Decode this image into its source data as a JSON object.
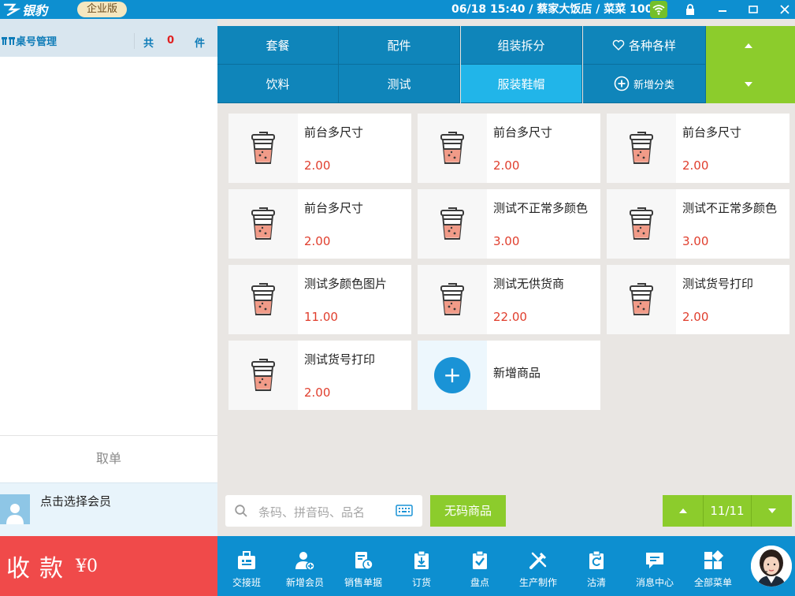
{
  "app": {
    "logo_text": "银豹",
    "edition": "企业版",
    "datetime": "06/18 15:40",
    "store": "蔡家大饭店",
    "user": "菜菜 1001"
  },
  "left_panel": {
    "title": "桌号管理",
    "total_prefix": "共",
    "total_count": "0",
    "total_suffix": "件",
    "cancel_label": "取单",
    "member_label": "点击选择会员",
    "pay_label": "收款",
    "pay_amount": "¥0"
  },
  "categories": {
    "row1": [
      "套餐",
      "配件",
      "组装拆分",
      "各种各样"
    ],
    "row2": [
      "饮料",
      "测试",
      "服装鞋帽"
    ],
    "add_label": "新增分类",
    "active": "服装鞋帽"
  },
  "products": [
    {
      "name": "前台多尺寸",
      "price": "2.00"
    },
    {
      "name": "前台多尺寸",
      "price": "2.00"
    },
    {
      "name": "前台多尺寸",
      "price": "2.00"
    },
    {
      "name": "前台多尺寸",
      "price": "2.00"
    },
    {
      "name": "测试不正常多颜色",
      "price": "3.00"
    },
    {
      "name": "测试不正常多颜色",
      "price": "3.00"
    },
    {
      "name": "测试多颜色图片",
      "price": "11.00"
    },
    {
      "name": "测试无供货商",
      "price": "22.00"
    },
    {
      "name": "测试货号打印",
      "price": "2.00"
    },
    {
      "name": "测试货号打印",
      "price": "2.00"
    }
  ],
  "add_product_label": "新增商品",
  "search": {
    "placeholder": "条码、拼音码、品名"
  },
  "no_code_label": "无码商品",
  "pagination": "11/11",
  "bottom_nav": [
    "交接班",
    "新增会员",
    "销售单据",
    "订货",
    "盘点",
    "生产制作",
    "沽清",
    "消息中心",
    "全部菜单"
  ],
  "colors": {
    "brand_blue": "#0d8fd0",
    "active_tab": "#21b5e9",
    "green": "#8ccc2c",
    "pay_red": "#f04a4a",
    "price_red": "#e03e2d"
  }
}
